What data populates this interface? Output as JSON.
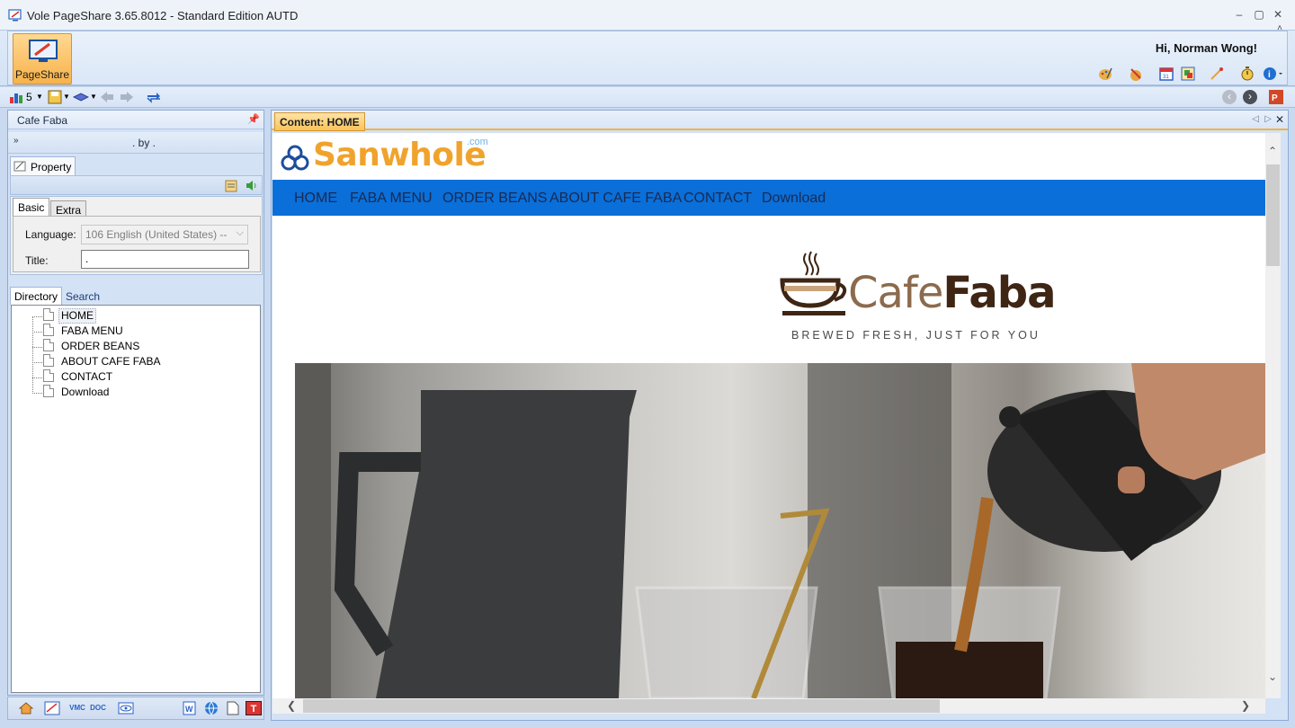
{
  "window": {
    "title": "Vole PageShare  3.65.8012 - Standard Edition AUTD",
    "minimize": "–",
    "maximize": "▢",
    "close": "✕"
  },
  "ribbon": {
    "main_button": "PageShare",
    "greeting": "Hi, Norman Wong!",
    "collapse": "˄",
    "icons": [
      "palette-icon",
      "paint-tool-icon",
      "calendar-icon",
      "gallery-icon",
      "magic-wand-icon",
      "stopwatch-icon",
      "info-icon"
    ]
  },
  "toolbar": {
    "count": "5",
    "icons": [
      "chart-icon",
      "save-icon",
      "layers-icon",
      "back-arrow-icon",
      "forward-arrow-icon",
      "swap-icon"
    ],
    "nav_back": "‹",
    "nav_forward": "›"
  },
  "left_panel": {
    "title": "Cafe Faba",
    "pin": "🖈",
    "subtitle": ". by .",
    "property_tab": "Property",
    "tabs": {
      "basic": "Basic",
      "extra": "Extra"
    },
    "language_label": "Language:",
    "language_value": "106 English (United States) --",
    "title_label": "Title:",
    "title_value": ".",
    "dir_tabs": {
      "directory": "Directory",
      "search": "Search"
    },
    "tree": [
      "HOME",
      "FABA MENU",
      "ORDER BEANS",
      "ABOUT CAFE FABA",
      "CONTACT",
      "Download"
    ]
  },
  "bottom_bar": {
    "icons": [
      "home-icon",
      "vmc-edit-icon",
      "vmc-icon",
      "doc-icon",
      "eye-icon",
      "word-icon",
      "globe-icon",
      "new-doc-icon",
      "text-icon"
    ],
    "vmc": "VMC",
    "doc": "DOC",
    "t": "T"
  },
  "content": {
    "tab_label": "Content: HOME",
    "site": {
      "logo": "Sanwhole",
      "logo_suffix": ".com",
      "nav": [
        "HOME",
        "FABA MENU",
        "ORDER BEANS",
        "ABOUT CAFE FABA",
        "CONTACT",
        "Download"
      ],
      "brand_light": "Cafe",
      "brand_bold": "Faba",
      "tagline": "BREWED FRESH, JUST FOR YOU"
    }
  },
  "colors": {
    "nav_bar": "#0a6fd8",
    "logo": "#f0a32c",
    "tab_active": "#f9c35b",
    "brand_dark": "#3e2514",
    "brand_light": "#8c6a4d"
  }
}
